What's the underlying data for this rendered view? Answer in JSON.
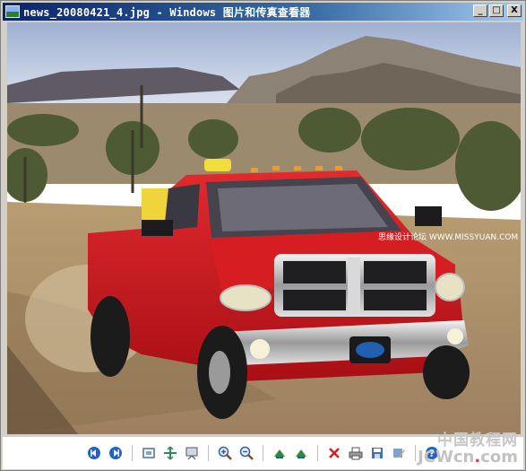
{
  "window": {
    "title": "news_20080421_4.jpg - Windows 图片和传真查看器",
    "buttons": {
      "minimize": "_",
      "maximize": "□",
      "close": "X"
    }
  },
  "image": {
    "watermark": "思缘设计论坛 WWW.MISSYUAN.COM"
  },
  "toolbar": {
    "items": [
      {
        "name": "previous-image-button",
        "icon": "prev-circle-icon"
      },
      {
        "name": "next-image-button",
        "icon": "next-circle-icon"
      },
      {
        "name": "best-fit-button",
        "icon": "best-fit-icon"
      },
      {
        "name": "actual-size-button",
        "icon": "actual-size-icon"
      },
      {
        "name": "slideshow-button",
        "icon": "slideshow-icon"
      },
      {
        "name": "zoom-in-button",
        "icon": "zoom-in-icon"
      },
      {
        "name": "zoom-out-button",
        "icon": "zoom-out-icon"
      },
      {
        "name": "rotate-clockwise-button",
        "icon": "rotate-cw-icon"
      },
      {
        "name": "rotate-counterclockwise-button",
        "icon": "rotate-ccw-icon"
      },
      {
        "name": "delete-button",
        "icon": "delete-icon"
      },
      {
        "name": "print-button",
        "icon": "print-icon"
      },
      {
        "name": "copy-to-button",
        "icon": "save-icon"
      },
      {
        "name": "open-for-editing-button",
        "icon": "edit-icon"
      },
      {
        "name": "help-button",
        "icon": "help-icon"
      }
    ]
  },
  "corner_brand": {
    "cn": "中国教程网",
    "en_prefix": "JCWcn",
    "en_dot": ".",
    "en_suffix": "com"
  },
  "colors": {
    "title_gradient_start": "#0a246a",
    "title_gradient_end": "#a6caf0",
    "truck_red": "#c8141b",
    "sky": "#cfd8ea"
  }
}
